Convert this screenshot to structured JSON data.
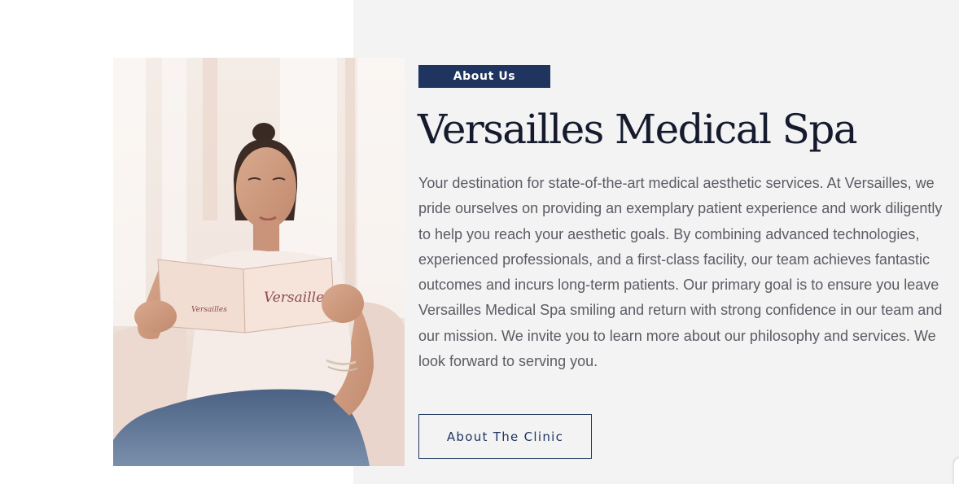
{
  "about_section": {
    "badge_label": "About Us",
    "heading": "Versailles Medical Spa",
    "description": "Your destination for state-of-the-art medical aesthetic services. At Versailles, we pride ourselves on providing an exemplary patient experience and work diligently to help you reach your aesthetic goals. By combining advanced technologies, experienced professionals, and a first-class facility, our team achieves fantastic outcomes and incurs long-term patients. Our primary goal is to ensure you leave Versailles Medical Spa smiling and return with strong confidence in our team and our mission. We invite you to learn more about our philosophy and services. We look forward to serving you.",
    "cta_label": "About The Clinic",
    "photo_booklet_text": "Versailles"
  },
  "colors": {
    "accent_navy": "#1f3560",
    "heading_text": "#151b2d",
    "body_text": "#5b5b63",
    "panel_background": "#f3f3f4"
  }
}
